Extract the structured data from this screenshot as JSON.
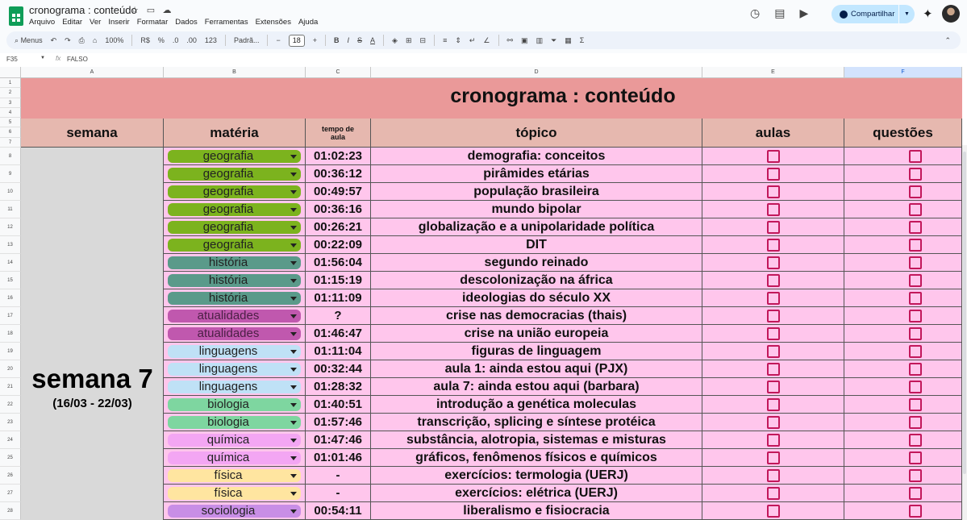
{
  "app": {
    "doc_title": "cronograma : conteúdo",
    "menu": [
      "Arquivo",
      "Editar",
      "Ver",
      "Inserir",
      "Formatar",
      "Dados",
      "Ferramentas",
      "Extensões",
      "Ajuda"
    ],
    "share_label": "Compartilhar"
  },
  "toolbar": {
    "search_label": "Menus",
    "zoom": "100%",
    "currency": "R$",
    "percent": "%",
    "dec_less": ".0",
    "dec_more": ".00",
    "number_fmt": "123",
    "font": "Padrã...",
    "font_size": "18"
  },
  "formula": {
    "cell_ref": "F35",
    "fx": "fx",
    "value": "FALSO"
  },
  "columns": [
    "A",
    "B",
    "C",
    "D",
    "E",
    "F"
  ],
  "row_numbers": [
    "1",
    "2",
    "3",
    "4",
    "5",
    "6",
    "7",
    "8",
    "9",
    "10",
    "11",
    "12",
    "13",
    "14",
    "15",
    "16",
    "17",
    "18",
    "19",
    "20",
    "21",
    "22",
    "23",
    "24",
    "25",
    "26",
    "27",
    "28"
  ],
  "sheet": {
    "title": "cronograma : conteúdo",
    "headers": {
      "semana": "semana",
      "materia": "matéria",
      "tempo": "tempo de aula",
      "topico": "tópico",
      "aulas": "aulas",
      "questoes": "questões"
    },
    "week_label": "semana 7",
    "week_range": "(16/03 - 22/03)",
    "subject_colors": {
      "geografia": "#7cb31e",
      "história": "#5a9a8a",
      "atualidades": "#c058ae",
      "linguagens": "#bfe1f6",
      "biologia": "#7ed6a0",
      "química": "#f3a6f3",
      "física": "#ffe5a0",
      "sociologia": "#c88ee6"
    },
    "rows": [
      {
        "materia": "geografia",
        "tempo": "01:02:23",
        "topico": "demografia: conceitos"
      },
      {
        "materia": "geografia",
        "tempo": "00:36:12",
        "topico": "pirâmides etárias"
      },
      {
        "materia": "geografia",
        "tempo": "00:49:57",
        "topico": "população brasileira"
      },
      {
        "materia": "geografia",
        "tempo": "00:36:16",
        "topico": "mundo bipolar"
      },
      {
        "materia": "geografia",
        "tempo": "00:26:21",
        "topico": "globalização e a unipolaridade política"
      },
      {
        "materia": "geografia",
        "tempo": "00:22:09",
        "topico": "DIT"
      },
      {
        "materia": "história",
        "tempo": "01:56:04",
        "topico": "segundo reinado"
      },
      {
        "materia": "história",
        "tempo": "01:15:19",
        "topico": "descolonização na áfrica"
      },
      {
        "materia": "história",
        "tempo": "01:11:09",
        "topico": "ideologias do século XX"
      },
      {
        "materia": "atualidades",
        "tempo": "?",
        "topico": "crise nas democracias (thais)"
      },
      {
        "materia": "atualidades",
        "tempo": "01:46:47",
        "topico": "crise na união europeia"
      },
      {
        "materia": "linguagens",
        "tempo": "01:11:04",
        "topico": "figuras de linguagem"
      },
      {
        "materia": "linguagens",
        "tempo": "00:32:44",
        "topico": "aula 1: ainda estou aqui (PJX)"
      },
      {
        "materia": "linguagens",
        "tempo": "01:28:32",
        "topico": "aula 7: ainda estou aqui (barbara)"
      },
      {
        "materia": "biologia",
        "tempo": "01:40:51",
        "topico": "introdução a genética moleculas"
      },
      {
        "materia": "biologia",
        "tempo": "01:57:46",
        "topico": "transcrição, splicing e síntese protéica"
      },
      {
        "materia": "química",
        "tempo": "01:47:46",
        "topico": "substância, alotropia, sistemas e misturas"
      },
      {
        "materia": "química",
        "tempo": "01:01:46",
        "topico": "gráficos, fenômenos físicos e químicos"
      },
      {
        "materia": "física",
        "tempo": "-",
        "topico": "exercícios: termologia (UERJ)"
      },
      {
        "materia": "física",
        "tempo": "-",
        "topico": "exercícios: elétrica (UERJ)"
      },
      {
        "materia": "sociologia",
        "tempo": "00:54:11",
        "topico": "liberalismo e fisiocracia"
      }
    ]
  }
}
